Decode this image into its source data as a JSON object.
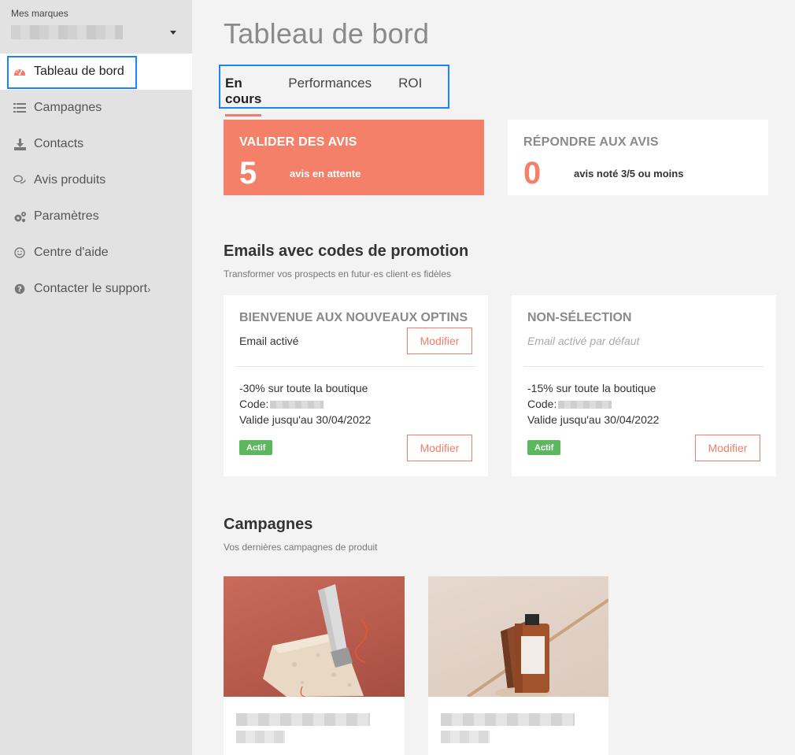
{
  "sidebar": {
    "brand_label": "Mes marques",
    "items": [
      {
        "label": "Tableau de bord",
        "icon": "dashboard-icon"
      },
      {
        "label": "Campagnes",
        "icon": "list-icon"
      },
      {
        "label": "Contacts",
        "icon": "download-icon"
      },
      {
        "label": "Avis produits",
        "icon": "comments-icon"
      },
      {
        "label": "Paramètres",
        "icon": "gears-icon"
      },
      {
        "label": "Centre d'aide",
        "icon": "smile-icon"
      },
      {
        "label": "Contacter le support",
        "icon": "question-circle-icon"
      }
    ]
  },
  "main": {
    "title": "Tableau de bord",
    "tabs": [
      {
        "label": "En cours"
      },
      {
        "label": "Performances"
      },
      {
        "label": "ROI"
      }
    ],
    "review_cards": [
      {
        "title": "VALIDER DES AVIS",
        "count": "5",
        "subtitle": "avis en attente"
      },
      {
        "title": "RÉPONDRE AUX AVIS",
        "count": "0",
        "subtitle": "avis noté 3/5 ou moins"
      }
    ],
    "promo_section": {
      "title": "Emails avec codes de promotion",
      "subtitle": "Transformer vos prospects en futur·es client·es fidèles",
      "cards": [
        {
          "title": "BIENVENUE AUX NOUVEAUX OPTINS",
          "status": "Email activé",
          "discount": "-30% sur toute la boutique",
          "code_label": "Code:",
          "validity": "Valide jusqu'au 30/04/2022",
          "badge": "Actif",
          "modify_label": "Modifier"
        },
        {
          "title": "NON-SÉLECTION",
          "status": "Email activé par défaut",
          "discount": "-15% sur toute la boutique",
          "code_label": "Code:",
          "validity": "Valide jusqu'au 30/04/2022",
          "badge": "Actif",
          "modify_label": "Modifier"
        }
      ]
    },
    "campaigns_section": {
      "title": "Campagnes",
      "subtitle": "Vos dernières campagnes de produit"
    }
  },
  "colors": {
    "accent": "#f47c67",
    "active_badge": "#5cb85c",
    "highlight_outline": "#1a84ff"
  }
}
